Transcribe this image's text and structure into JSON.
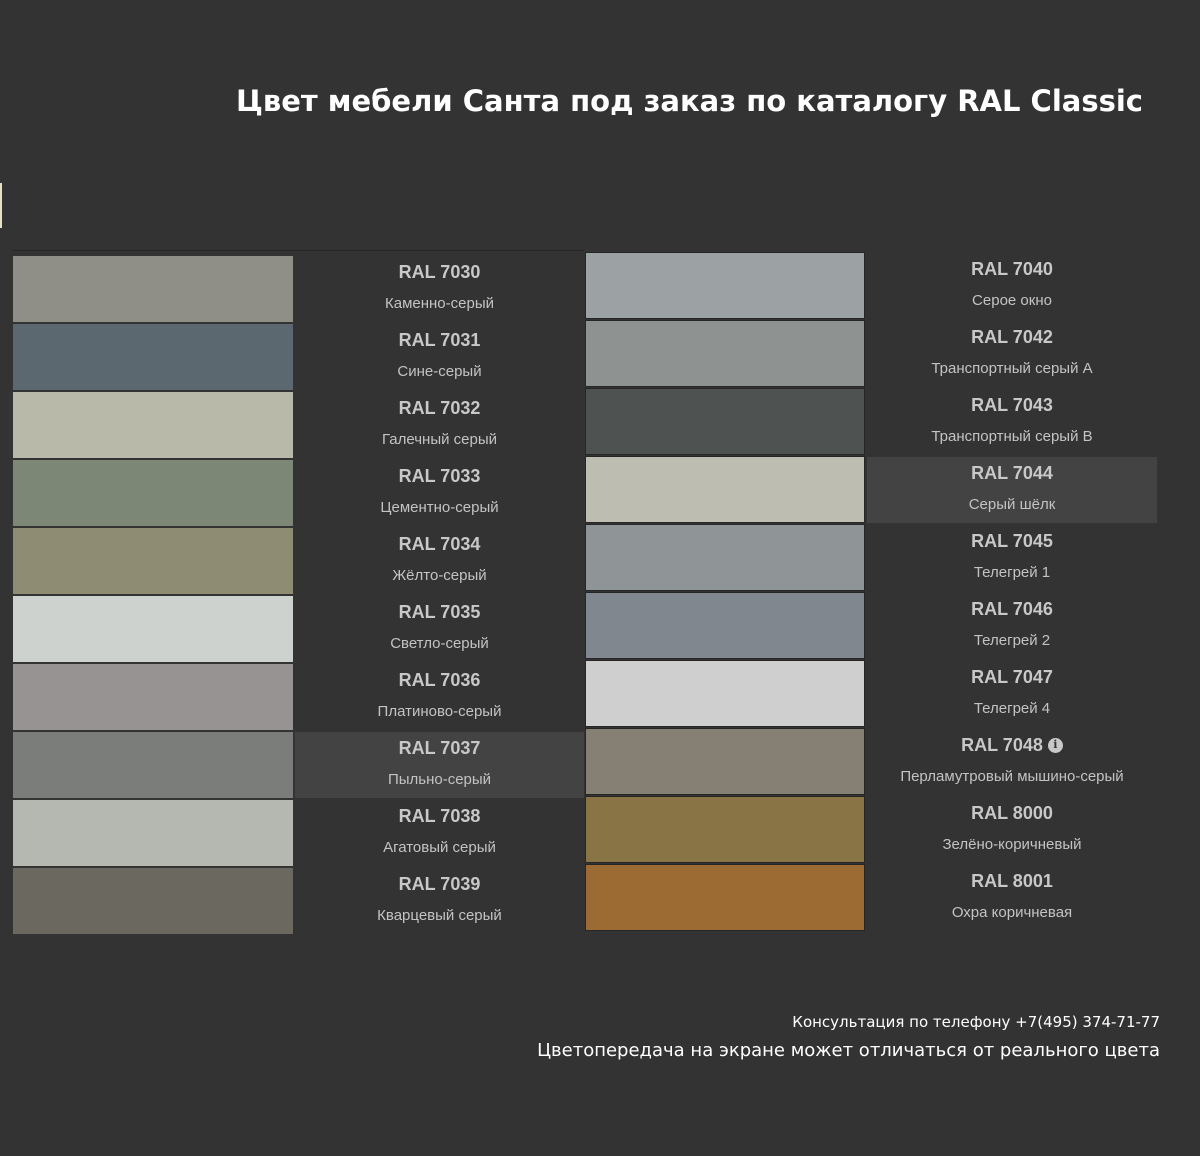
{
  "title": "Цвет мебели Санта под заказ по каталогу RAL Classic",
  "left_column": [
    {
      "code": "RAL 7030",
      "name": "Каменно-серый",
      "color": "#8f8f87",
      "highlight": false
    },
    {
      "code": "RAL 7031",
      "name": "Сине-серый",
      "color": "#5b6870",
      "highlight": false
    },
    {
      "code": "RAL 7032",
      "name": "Галечный серый",
      "color": "#b8b9a9",
      "highlight": false
    },
    {
      "code": "RAL 7033",
      "name": "Цементно-серый",
      "color": "#7d8776",
      "highlight": false
    },
    {
      "code": "RAL 7034",
      "name": "Жёлто-серый",
      "color": "#8f8c74",
      "highlight": false
    },
    {
      "code": "RAL 7035",
      "name": "Светло-серый",
      "color": "#cdd2cf",
      "highlight": false
    },
    {
      "code": "RAL 7036",
      "name": "Платиново-серый",
      "color": "#969392",
      "highlight": false
    },
    {
      "code": "RAL 7037",
      "name": "Пыльно-серый",
      "color": "#7b7d7b",
      "highlight": true
    },
    {
      "code": "RAL 7038",
      "name": "Агатовый серый",
      "color": "#b5b8b1",
      "highlight": false
    },
    {
      "code": "RAL 7039",
      "name": "Кварцевый серый",
      "color": "#6b685f",
      "highlight": false
    }
  ],
  "right_column": [
    {
      "code": "RAL 7040",
      "name": "Серое окно",
      "color": "#9ca1a4",
      "highlight": false,
      "info": false
    },
    {
      "code": "RAL 7042",
      "name": "Транспортный серый А",
      "color": "#8e9392",
      "highlight": false,
      "info": false
    },
    {
      "code": "RAL 7043",
      "name": "Транспортный серый В",
      "color": "#4e5351",
      "highlight": false,
      "info": false
    },
    {
      "code": "RAL 7044",
      "name": "Серый шёлк",
      "color": "#bebdb2",
      "highlight": true,
      "info": false
    },
    {
      "code": "RAL 7045",
      "name": "Телегрей 1",
      "color": "#8f9496",
      "highlight": false,
      "info": false
    },
    {
      "code": "RAL 7046",
      "name": "Телегрей 2",
      "color": "#80878e",
      "highlight": false,
      "info": false
    },
    {
      "code": "RAL 7047",
      "name": "Телегрей 4",
      "color": "#cfcfcf",
      "highlight": false,
      "info": false
    },
    {
      "code": "RAL 7048",
      "name": "Перламутровый мышино-серый",
      "color": "#867f74",
      "highlight": false,
      "info": true
    },
    {
      "code": "RAL 8000",
      "name": "Зелёно-коричневый",
      "color": "#887445",
      "highlight": false,
      "info": false
    },
    {
      "code": "RAL 8001",
      "name": "Охра коричневая",
      "color": "#9c6a33",
      "highlight": false,
      "info": false
    }
  ],
  "footer": {
    "phone_line": "Консультация по телефону +7(495) 374-71-77",
    "disclaimer": "Цветопередача на экране может отличаться от реального цвета"
  }
}
